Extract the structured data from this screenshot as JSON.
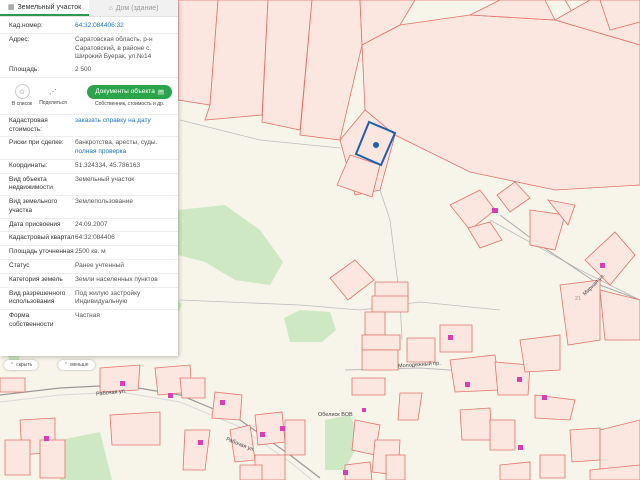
{
  "tabs": {
    "parcel": {
      "icon": "parcel-icon",
      "label": "Земельный участок"
    },
    "house": {
      "icon": "house-icon",
      "label": "Дом (здание)"
    }
  },
  "info": {
    "cadnum": {
      "label": "Кад.номер:",
      "value": "64:32:084406:32"
    },
    "address": {
      "label": "Адрес:",
      "value": "Саратовская область, р-н Саратовский, в районе с. Широкий Буерак, ул.№14"
    },
    "area": {
      "label": "Площадь:",
      "value": "2 500"
    }
  },
  "actions": {
    "list_label": "В список",
    "share_label": "Поделиться",
    "docs_button": "Документы объекта",
    "docs_sub": "Собственник, стоимость и др."
  },
  "details": {
    "cad_cost": {
      "label": "Кадастровая стоимость:",
      "value": "заказать справку на дату"
    },
    "risks": {
      "label": "Риски при сделке:",
      "value": "банкротства, аресты, суды.",
      "link": "полная проверка"
    },
    "coords": {
      "label": "Координаты:",
      "value": "51.324334, 45.786163"
    },
    "object_kind": {
      "label": "Вид объекта недвижимости",
      "value": "Земельный участок"
    },
    "land_use_kind": {
      "label": "Вид земельного участка",
      "value": "Землепользование"
    },
    "date": {
      "label": "Дата присвоения",
      "value": "24.09.2007"
    },
    "quarter": {
      "label": "Кадастровый квартал",
      "value": "64:32:084406"
    },
    "area_refined": {
      "label": "Площадь уточненная",
      "value": "2500 кв. м"
    },
    "status": {
      "label": "Статус",
      "value": "Ранее учтенный"
    },
    "category": {
      "label": "Категория земель",
      "value": "Земли населенных пунктов"
    },
    "permitted_use": {
      "label": "Вид разрешенного использования",
      "value": "Под жилую застройку Индивидуальную"
    },
    "ownership": {
      "label": "Форма собственности",
      "value": "Частная"
    }
  },
  "controls": {
    "open_label": "скрыть",
    "less_label": "меньше"
  },
  "map_labels": {
    "street_rabochaya_1": "Рабочая ул.",
    "street_rabochaya_2": "Рабочая ул.",
    "street_molodezhny": "Молодежный пр.",
    "street_right": "Мирная ул.",
    "obelisk": "Обелиск ВОВ",
    "parcel_num": "21"
  },
  "colors": {
    "accent": "#2ca54a",
    "parcel_line": "#e3736a",
    "parcel_fill": "#fbe6e0",
    "selected": "#1f5fb0",
    "forest": "#cfe8c4",
    "link": "#1d74c8"
  }
}
